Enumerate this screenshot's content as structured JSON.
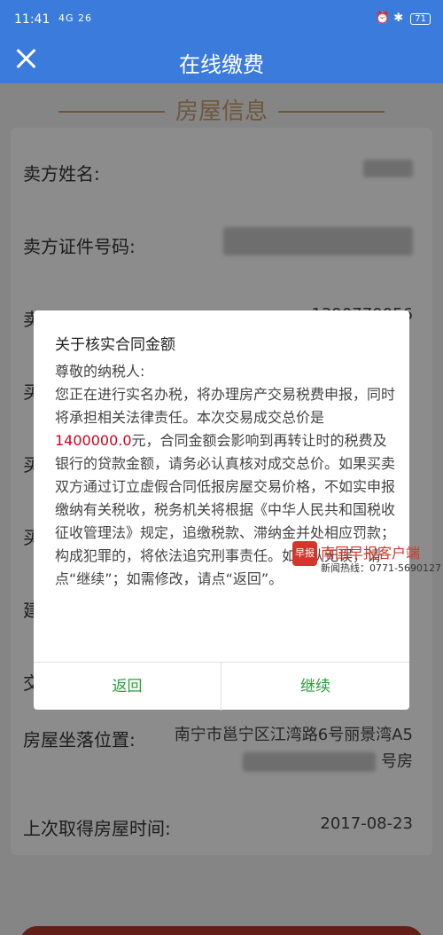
{
  "status": {
    "time": "11:41",
    "signal": "4G 26",
    "battery": "71"
  },
  "header": {
    "title": "在线缴费"
  },
  "section": {
    "title": "房屋信息"
  },
  "fields": [
    {
      "label": "卖方姓名:",
      "value": ""
    },
    {
      "label": "卖方证件号码:",
      "value": ""
    },
    {
      "label": "卖方电话",
      "value": "1390770056"
    },
    {
      "label": "买",
      "value": ""
    },
    {
      "label": "买",
      "value": ""
    },
    {
      "label": "买",
      "value": ""
    },
    {
      "label": "建",
      "value": ""
    },
    {
      "label": "交",
      "value": ""
    },
    {
      "label": "房屋坐落位置:",
      "value": "南宁市邕宁区江湾路6号丽景湾A5",
      "value2": "号房"
    },
    {
      "label": "上次取得房屋时间:",
      "value": "2017-08-23"
    }
  ],
  "dialog": {
    "title": "关于核实合同金额",
    "greeting": "尊敬的纳税人:",
    "text_before": "您正在进行实名办税，将办理房产交易税费申报，同时将承担相关法律责任。本次交易成交总价是",
    "amount": "1400000.0",
    "text_after": "元，合同金额会影响到再转让时的税费及银行的贷款金额，请务必认真核对成交总价。如果买卖双方通过订立虚假合同低报房屋交易价格，不如实申报缴纳有关税收，税务机关将根据《中华人民共和国税收征收管理法》规定，追缴税款、滞纳金并处相应罚款；构成犯罪的，将依法追究刑事责任。如确认无误，请点“继续”；如需修改，请点“返回”。",
    "back_label": "返回",
    "continue_label": "继续"
  },
  "watermark": {
    "logo": "早报",
    "name": "南国早报客户端",
    "hotline": "新闻热线：0771-5690127"
  },
  "colors": {
    "primary": "#3a7bdc",
    "accent": "#c9a06b",
    "amount": "#d0021b",
    "button_text": "#2a9d3a"
  }
}
